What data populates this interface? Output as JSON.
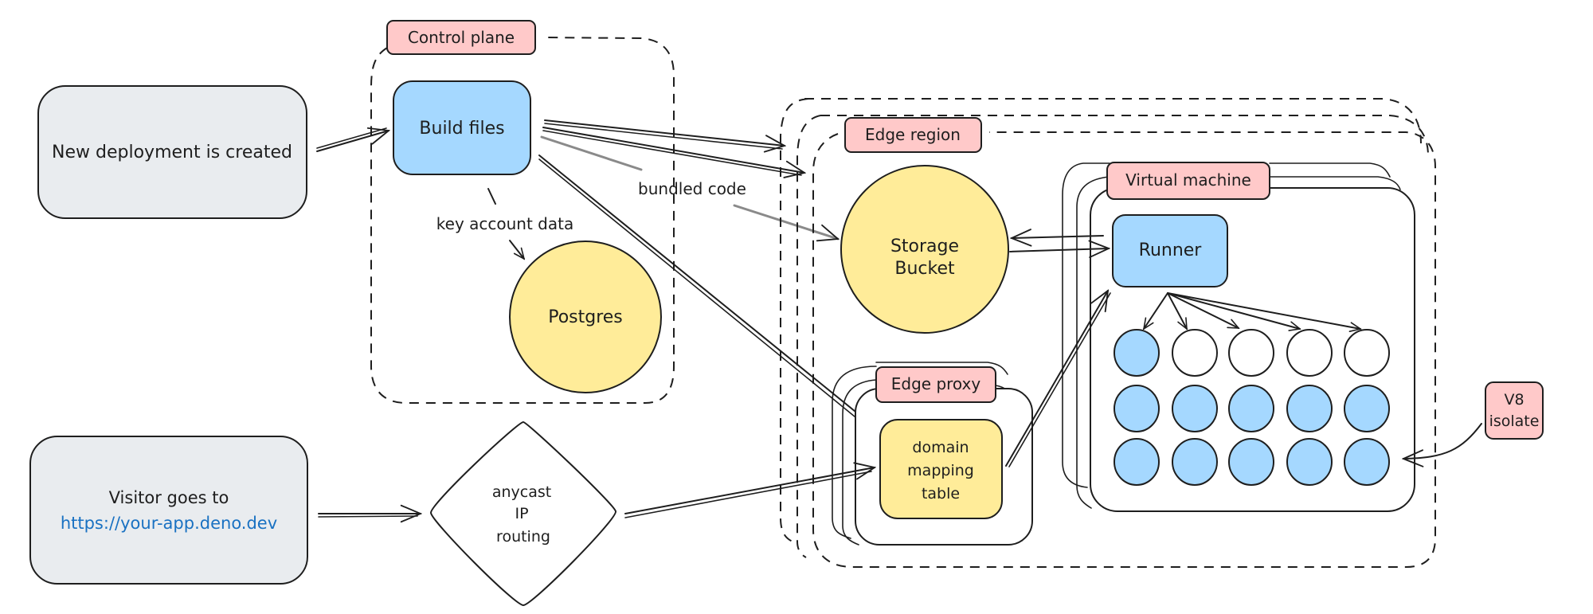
{
  "colors": {
    "stroke": "#1e1e1e",
    "grey_box": "#e9ecef",
    "blue_box": "#a5d8ff",
    "yellow_box": "#ffec99",
    "pink_label": "#ffc9c9",
    "link": "#1971c2",
    "white": "#ffffff"
  },
  "nodes": {
    "new_deployment": "New deployment is created",
    "control_plane_label": "Control plane",
    "build_files": "Build files",
    "postgres": "Postgres",
    "edge_region_label": "Edge region",
    "storage_bucket_line1": "Storage",
    "storage_bucket_line2": "Bucket",
    "virtual_machine_label": "Virtual machine",
    "runner": "Runner",
    "edge_proxy_label": "Edge proxy",
    "domain_mapping_line1": "domain",
    "domain_mapping_line2": "mapping",
    "domain_mapping_line3": "table",
    "v8_isolate_line1": "V8",
    "v8_isolate_line2": "isolate",
    "visitor_line1": "Visitor goes to",
    "visitor_link": "https://your-app.deno.dev",
    "anycast_line1": "anycast",
    "anycast_line2": "IP",
    "anycast_line3": "routing"
  },
  "edge_labels": {
    "key_account_data": "key account data",
    "bundled_code": "bundled code"
  },
  "isolate_grid": {
    "rows": 3,
    "cols": 5,
    "filled": [
      [
        true,
        false,
        false,
        false,
        false
      ],
      [
        true,
        true,
        true,
        true,
        true
      ],
      [
        true,
        true,
        true,
        true,
        true
      ]
    ]
  }
}
